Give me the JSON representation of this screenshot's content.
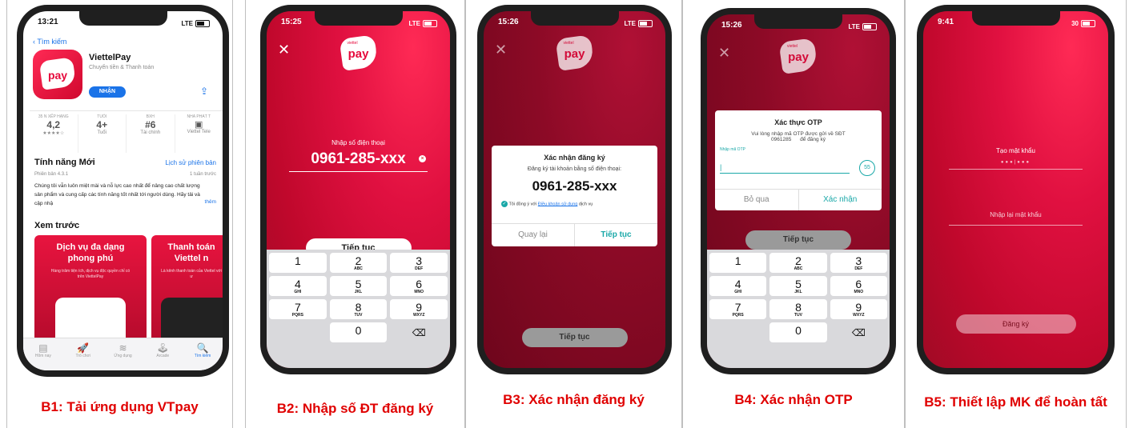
{
  "steps": [
    {
      "caption": "B1: Tải ứng dụng VTpay"
    },
    {
      "caption": "B2: Nhập số ĐT đăng ký"
    },
    {
      "caption": "B3: Xác nhận đăng ký"
    },
    {
      "caption": "B4: Xác nhận OTP"
    },
    {
      "caption": "B5: Thiết lập MK để hoàn tất"
    }
  ],
  "status_times": [
    "13:21",
    "15:25",
    "15:26",
    "15:26",
    "9:41"
  ],
  "network": "LTE",
  "network_b5": "30",
  "logo_text": "pay",
  "logo_small": "viettel",
  "appstore": {
    "back_label": "Tìm kiếm",
    "app_name": "ViettelPay",
    "app_subtitle": "Chuyển tiền & Thanh toán",
    "get_button": "NHẬN",
    "stats": [
      {
        "label": "35 N XẾP HẠNG",
        "value": "4,2",
        "sub": "★★★★☆"
      },
      {
        "label": "TUỔI",
        "value": "4+",
        "sub": "Tuổi"
      },
      {
        "label": "BXH",
        "value": "#6",
        "sub": "Tài chính"
      },
      {
        "label": "NHÀ PHÁT T",
        "value": "",
        "sub": "Viettel Tele"
      }
    ],
    "whats_new_title": "Tính năng Mới",
    "version_history": "Lịch sử phiên bản",
    "version": "Phiên bản 4.3.1",
    "version_time": "1 tuần trước",
    "description": "Chúng tôi vẫn luôn miệt mài và nỗ lực cao nhất để nâng cao chất lượng sản phẩm và cung cấp các tính năng tốt nhất tới người dùng. Hãy tải và cập nhậ",
    "more_label": "thêm",
    "preview_title": "Xem trước",
    "preview_cards": [
      {
        "title": "Dịch vụ đa dạng phong phú",
        "sub": "Hàng trăm tiện ích, dịch vụ độc quyền chỉ có trên ViettelPay"
      },
      {
        "title": "Thanh toán Viettel n",
        "sub": "Là kênh thanh toán của Viettel với ư"
      }
    ],
    "tabs": [
      {
        "label": "Hôm nay",
        "icon": "today-icon",
        "glyph": "▤"
      },
      {
        "label": "Trò chơi",
        "icon": "games-icon",
        "glyph": "🚀"
      },
      {
        "label": "Ứng dụng",
        "icon": "apps-icon",
        "glyph": "≋"
      },
      {
        "label": "Arcade",
        "icon": "arcade-icon",
        "glyph": "🕹"
      },
      {
        "label": "Tìm kiếm",
        "icon": "search-icon",
        "glyph": "🔍"
      }
    ]
  },
  "b2": {
    "prompt": "Nhập số điện thoại",
    "phone": "0961-285-xxx",
    "continue": "Tiếp tục"
  },
  "b3": {
    "title": "Xác nhận đăng ký",
    "subtitle": "Đăng ký tài khoản bằng số điện thoại:",
    "phone": "0961-285-xxx",
    "agree_prefix": "Tôi đồng ý với",
    "agree_link": "Điều khoản sử dụng",
    "agree_suffix": "dịch vụ",
    "back": "Quay lại",
    "continue": "Tiếp tục",
    "bottom_button": "Tiếp tục"
  },
  "b4": {
    "title": "Xác thực OTP",
    "message_line1": "Vui lòng nhập mã OTP được gửi về SĐT",
    "message_line2": "0961285      để đăng ký",
    "otp_label": "Nhập mã OTP",
    "timer": "55",
    "skip": "Bỏ qua",
    "confirm": "Xác nhận",
    "continue": "Tiếp tục"
  },
  "keypad": [
    [
      {
        "d": "1",
        "l": ""
      },
      {
        "d": "2",
        "l": "ABC"
      },
      {
        "d": "3",
        "l": "DEF"
      }
    ],
    [
      {
        "d": "4",
        "l": "GHI"
      },
      {
        "d": "5",
        "l": "JKL"
      },
      {
        "d": "6",
        "l": "MNO"
      }
    ],
    [
      {
        "d": "7",
        "l": "PQRS"
      },
      {
        "d": "8",
        "l": "TUV"
      },
      {
        "d": "9",
        "l": "WXYZ"
      }
    ],
    [
      {
        "d": "",
        "l": ""
      },
      {
        "d": "0",
        "l": ""
      },
      {
        "d": "⌫",
        "l": ""
      }
    ]
  ],
  "b5": {
    "create_password": "Tạo mật khẩu",
    "password_mask": "●●●|●●●",
    "confirm_password": "Nhập lại mật khẩu",
    "register": "Đăng ký"
  }
}
